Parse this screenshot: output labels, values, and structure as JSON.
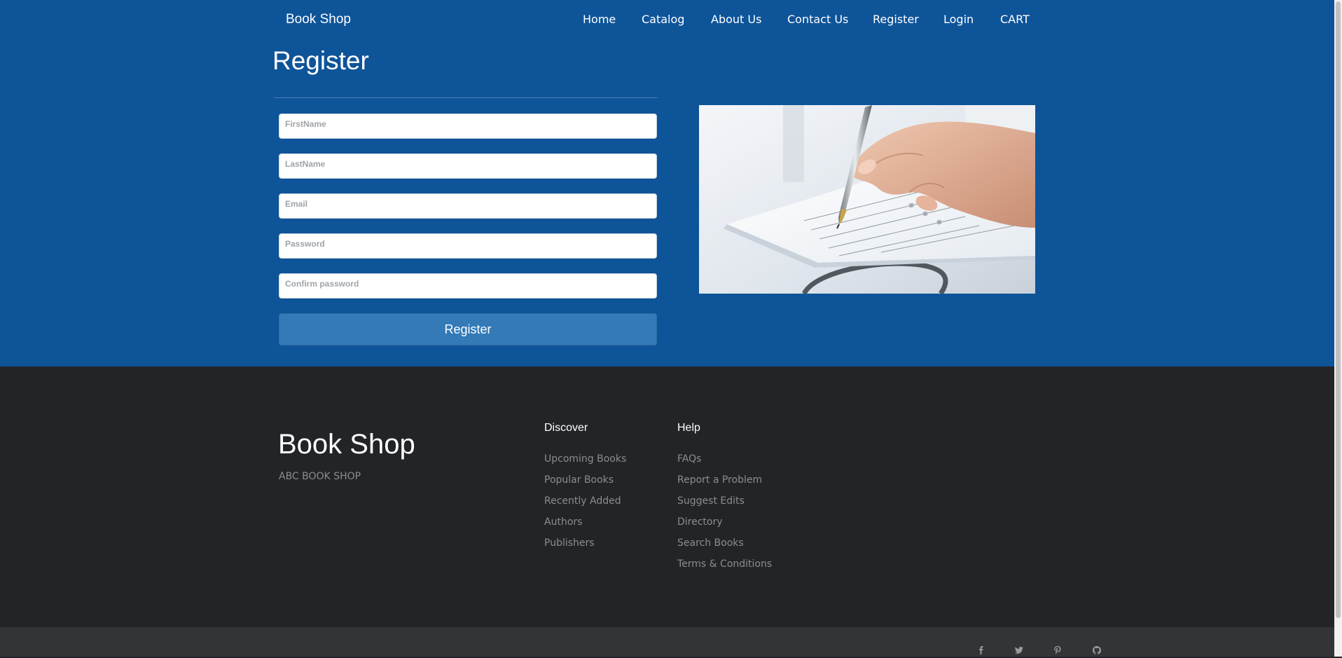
{
  "header": {
    "brand": "Book Shop",
    "nav": [
      {
        "label": "Home"
      },
      {
        "label": "Catalog"
      },
      {
        "label": "About Us"
      },
      {
        "label": "Contact Us"
      },
      {
        "label": "Register"
      },
      {
        "label": "Login"
      },
      {
        "label": "CART"
      }
    ]
  },
  "main": {
    "title": "Register",
    "form": {
      "firstname_placeholder": "FirstName",
      "lastname_placeholder": "LastName",
      "email_placeholder": "Email",
      "password_placeholder": "Password",
      "confirm_placeholder": "Confirm password",
      "submit_label": "Register"
    }
  },
  "footer": {
    "brand": "Book Shop",
    "tagline": "ABC BOOK SHOP",
    "discover": {
      "title": "Discover",
      "links": [
        "Upcoming Books",
        "Popular Books",
        "Recently Added",
        "Authors",
        "Publishers"
      ]
    },
    "help": {
      "title": "Help",
      "links": [
        "FAQs",
        "Report a Problem",
        "Suggest Edits",
        "Directory",
        "Search Books",
        "Terms & Conditions"
      ]
    },
    "social": [
      {
        "icon": "facebook-icon",
        "glyph": "f"
      },
      {
        "icon": "twitter-icon",
        "glyph": "t"
      },
      {
        "icon": "pinterest-icon",
        "glyph": "p"
      },
      {
        "icon": "github-icon",
        "glyph": "g"
      }
    ]
  },
  "colors": {
    "header_blue": "#0e5499",
    "button_blue": "#337ab7",
    "footer_dark": "#232427",
    "footer_bar": "#333438"
  }
}
